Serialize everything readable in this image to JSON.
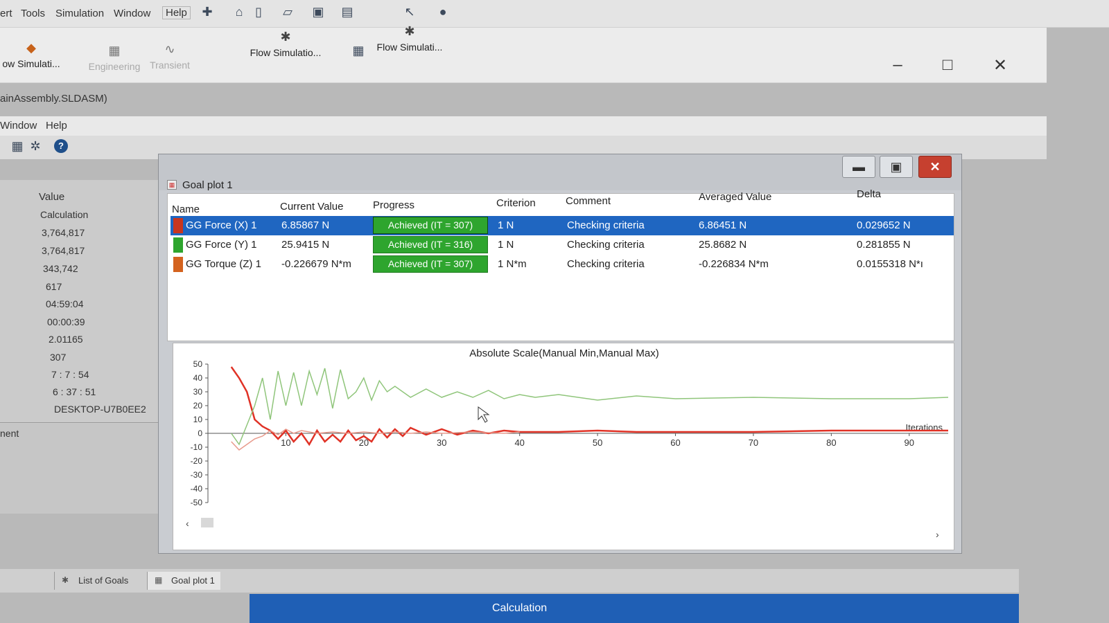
{
  "menubar": {
    "items": [
      "ert",
      "Tools",
      "Simulation",
      "Window",
      "Help"
    ]
  },
  "ribbon": {
    "buttons": [
      {
        "label": "ow Simulati...",
        "icon": "flow-simulation-icon"
      },
      {
        "label": "Engineering",
        "icon": "engineering-database-icon"
      },
      {
        "label": "Transient",
        "icon": "transient-explorer-icon"
      },
      {
        "label": "Flow Simulatio...",
        "icon": "flow-simulation-icon"
      },
      {
        "label": "Flow Simulati...",
        "icon": "flow-simulation-icon"
      }
    ]
  },
  "document": {
    "title": "ainAssembly.SLDASM)",
    "menu": [
      "Window",
      "Help"
    ]
  },
  "left_panel": {
    "header": "Value",
    "values": [
      "Calculation",
      "3,764,817",
      "3,764,817",
      "343,742",
      "617",
      "04:59:04",
      "00:00:39",
      "2.01165",
      "307",
      "7 : 7 : 54",
      "6 : 37 : 51",
      "DESKTOP-U7B0EE2"
    ],
    "footer_label": "nent"
  },
  "goal_plot": {
    "title": "Goal plot 1",
    "columns": [
      "Name",
      "Current Value",
      "Progress",
      "Criterion",
      "Comment",
      "Averaged Value",
      "Delta"
    ],
    "rows": [
      {
        "name": "GG Force (X) 1",
        "current": "6.85867 N",
        "progress": "Achieved (IT = 307)",
        "criterion": "1 N",
        "comment": "Checking criteria",
        "averaged": "6.86451 N",
        "delta": "0.029652 N",
        "color": "#c8361f"
      },
      {
        "name": "GG Force (Y) 1",
        "current": "25.9415 N",
        "progress": "Achieved (IT = 316)",
        "criterion": "1 N",
        "comment": "Checking criteria",
        "averaged": "25.8682 N",
        "delta": "0.281855 N",
        "color": "#2ea52e"
      },
      {
        "name": "GG Torque (Z) 1",
        "current": "-0.226679 N*m",
        "progress": "Achieved (IT = 307)",
        "criterion": "1 N*m",
        "comment": "Checking criteria",
        "averaged": "-0.226834 N*m",
        "delta": "0.0155318 N*ı",
        "color": "#d4631f"
      }
    ],
    "chart_data": {
      "type": "line",
      "title": "Absolute Scale(Manual Min,Manual Max)",
      "xlabel": "Iterations",
      "ylabel": "",
      "xlim": [
        0,
        95
      ],
      "ylim": [
        -50,
        50
      ],
      "x_ticks": [
        10,
        20,
        30,
        40,
        50,
        60,
        70,
        80,
        90
      ],
      "y_ticks": [
        50,
        40,
        30,
        20,
        10,
        0,
        -10,
        -20,
        -30,
        -40,
        -50
      ],
      "series": [
        {
          "color": "#e03226",
          "x": [
            3,
            4,
            5,
            6,
            7,
            8,
            9,
            10,
            11,
            12,
            13,
            14,
            15,
            16,
            17,
            18,
            19,
            20,
            21,
            22,
            23,
            24,
            25,
            26,
            28,
            30,
            32,
            34,
            36,
            38,
            40,
            45,
            50,
            55,
            60,
            70,
            80,
            90,
            95
          ],
          "y": [
            48,
            40,
            30,
            10,
            5,
            2,
            -4,
            2,
            -6,
            0,
            -8,
            2,
            -6,
            -1,
            -6,
            2,
            -5,
            -2,
            -6,
            3,
            -3,
            3,
            -2,
            4,
            -1,
            3,
            -1,
            2,
            0,
            2,
            1,
            1,
            2,
            1,
            1,
            1,
            2,
            2,
            2
          ]
        },
        {
          "color": "#8fc57a",
          "x": [
            3,
            4,
            5,
            6,
            7,
            8,
            9,
            10,
            11,
            12,
            13,
            14,
            15,
            16,
            17,
            18,
            19,
            20,
            21,
            22,
            23,
            24,
            26,
            28,
            30,
            32,
            34,
            36,
            38,
            40,
            42,
            45,
            50,
            55,
            60,
            70,
            80,
            90,
            95
          ],
          "y": [
            0,
            -8,
            6,
            20,
            40,
            10,
            45,
            20,
            44,
            20,
            45,
            28,
            47,
            18,
            46,
            25,
            30,
            40,
            24,
            38,
            30,
            34,
            26,
            32,
            26,
            30,
            26,
            31,
            25,
            28,
            26,
            28,
            24,
            27,
            25,
            26,
            25,
            25,
            26
          ]
        },
        {
          "color": "#e89a8c",
          "x": [
            3,
            4,
            5,
            6,
            7,
            8,
            9,
            10,
            11,
            12,
            14,
            16,
            18,
            20,
            22,
            24,
            26,
            28,
            30,
            34,
            38,
            40
          ],
          "y": [
            -6,
            -12,
            -8,
            -4,
            -2,
            2,
            -1,
            3,
            0,
            2,
            0,
            1,
            0,
            1,
            0,
            1,
            0,
            1,
            0,
            1,
            0,
            1
          ]
        }
      ]
    }
  },
  "bottom_tabs": [
    "List of Goals",
    "Goal plot 1"
  ],
  "status": {
    "text": "Calculation"
  }
}
